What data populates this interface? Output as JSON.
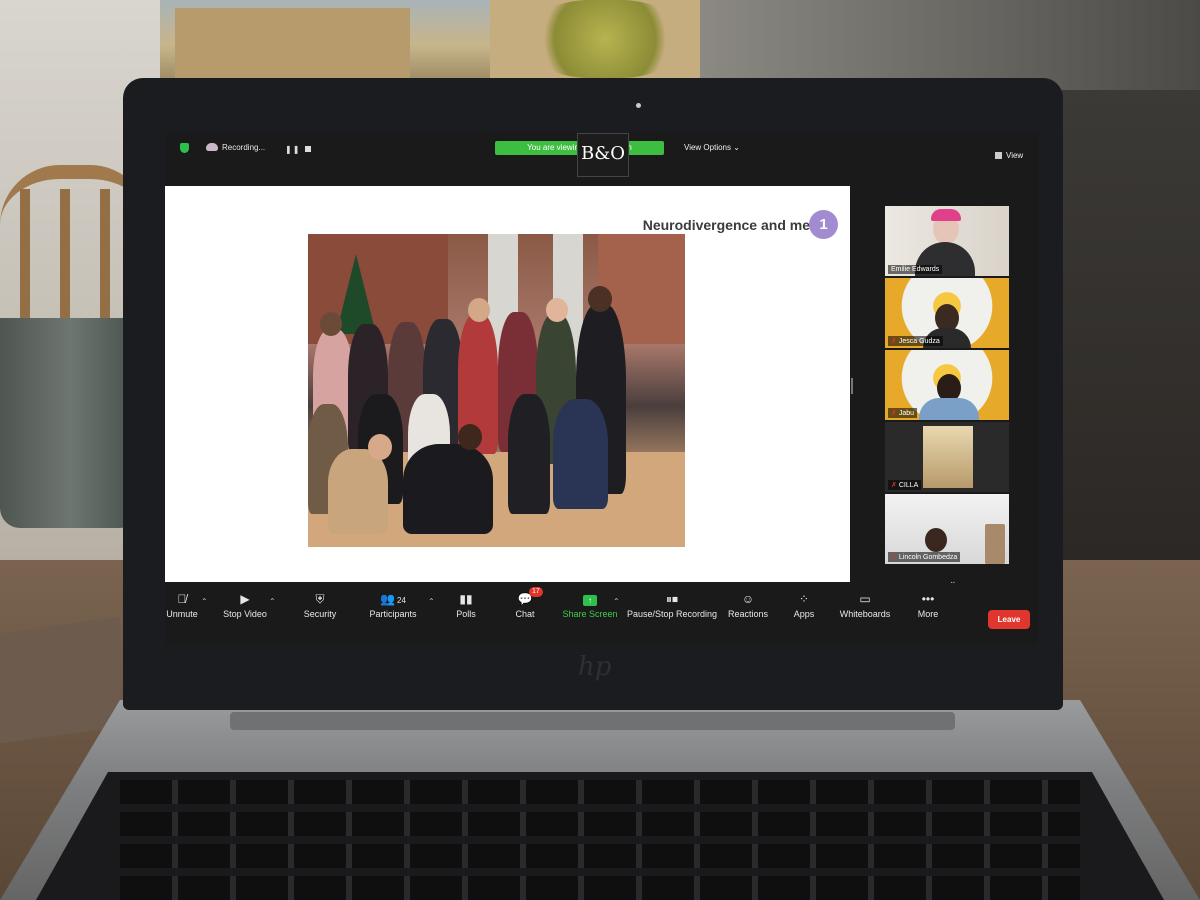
{
  "zoom_topbar": {
    "recording_label": "Recording...",
    "viewing_banner": "You are viewing Em… screen",
    "bo_badge": "B&O",
    "view_options": "View Options ⌄",
    "view_label": "View"
  },
  "slide": {
    "title": "Neurodivergence and me",
    "number": "1"
  },
  "gallery": {
    "participants": [
      {
        "name": "Emilie Edwards",
        "muted": false,
        "active": true
      },
      {
        "name": "Jesca Gudza",
        "muted": true,
        "active": false
      },
      {
        "name": "Jabu",
        "muted": true,
        "active": false
      },
      {
        "name": "CILLA",
        "muted": true,
        "active": false
      },
      {
        "name": "Lincoln Gombedza",
        "muted": true,
        "active": false
      }
    ]
  },
  "toolbar": {
    "unmute": "Unmute",
    "stop_video": "Stop Video",
    "security": "Security",
    "participants": "Participants",
    "participants_count": "24",
    "polls": "Polls",
    "chat": "Chat",
    "chat_badge": "17",
    "share_screen": "Share Screen",
    "pause_stop_recording": "Pause/Stop Recording",
    "reactions": "Reactions",
    "apps": "Apps",
    "whiteboards": "Whiteboards",
    "more": "More",
    "leave": "Leave"
  },
  "laptop": {
    "brand_logo": "hp"
  },
  "colors": {
    "zoom_green": "#3dbe40",
    "leave_red": "#e0362d",
    "slide_number_purple": "#a28bd0",
    "active_speaker_yellow": "#d6d22c"
  }
}
